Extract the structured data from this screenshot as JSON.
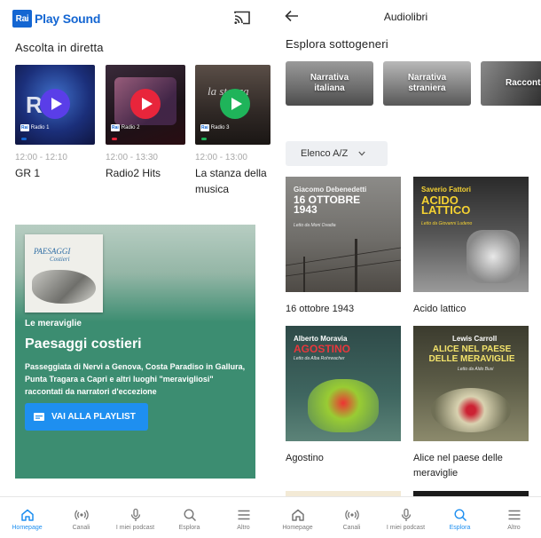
{
  "left": {
    "app_name": "Play Sound",
    "logo_badge": "Rai",
    "live_section_title": "Ascolta in diretta",
    "live": [
      {
        "time": "12:00 - 12:10",
        "name": "GR 1",
        "channel": "Radio 1",
        "play_color": "#5a3ee8",
        "dot_color": "#1466d2"
      },
      {
        "time": "12:00 - 13:30",
        "name": "Radio2 Hits",
        "channel": "Radio 2",
        "play_color": "#e8253b",
        "dot_color": "#e8253b"
      },
      {
        "time": "12:00 - 13:00",
        "name": "La stanza della musica",
        "channel": "Radio 3",
        "play_color": "#1fb45a",
        "dot_color": "#1fb45a"
      }
    ],
    "promo": {
      "cover_title": "PAESAGGI",
      "cover_subtitle": "Costieri",
      "kicker": "Le meraviglie",
      "title": "Paesaggi costieri",
      "description": "Passeggiata di Nervi a Genova, Costa Paradiso in Gallura, Punta Tragara a Capri e altri luoghi \"meravigliosi\" raccontati da narratori d'eccezione",
      "button_label": "VAI ALLA PLAYLIST"
    },
    "tabs": [
      {
        "label": "Homepage",
        "icon": "home-icon",
        "active": true
      },
      {
        "label": "Canali",
        "icon": "radio-waves-icon",
        "active": false
      },
      {
        "label": "I miei podcast",
        "icon": "microphone-icon",
        "active": false
      },
      {
        "label": "Esplora",
        "icon": "search-icon",
        "active": false
      },
      {
        "label": "Altro",
        "icon": "menu-icon",
        "active": false
      }
    ]
  },
  "right": {
    "title": "Audiolibri",
    "subgenres_title": "Esplora sottogeneri",
    "subgenres": [
      {
        "label": "Narrativa\nitaliana"
      },
      {
        "label": "Narrativa\nstraniera"
      },
      {
        "label": "Raccont"
      }
    ],
    "filter_label": "Elenco A/Z",
    "books": [
      {
        "title": "16 ottobre 1943",
        "cover_author": "Giacomo Debenedetti",
        "cover_title": "16 OTTOBRE 1943",
        "cover_reader": "Letto da Moni Ovadia"
      },
      {
        "title": "Acido lattico",
        "cover_author": "Saverio Fattori",
        "cover_title": "ACIDO LATTICO",
        "cover_reader": "Letto da Giovanni Ludeno"
      },
      {
        "title": "Agostino",
        "cover_author": "Alberto Moravia",
        "cover_title": "AGOSTINO",
        "cover_reader": "Letto da Alba Rohrwacher"
      },
      {
        "title": "Alice nel paese delle meraviglie",
        "cover_author": "Lewis Carroll",
        "cover_title": "ALICE NEL PAESE DELLE MERAVIGLIE",
        "cover_reader": "Letto da Aldo Busi"
      }
    ],
    "tabs": [
      {
        "label": "Homepage",
        "icon": "home-icon",
        "active": false
      },
      {
        "label": "Canali",
        "icon": "radio-waves-icon",
        "active": false
      },
      {
        "label": "I miei podcast",
        "icon": "microphone-icon",
        "active": false
      },
      {
        "label": "Esplora",
        "icon": "search-icon",
        "active": true
      },
      {
        "label": "Altro",
        "icon": "menu-icon",
        "active": false
      }
    ]
  }
}
